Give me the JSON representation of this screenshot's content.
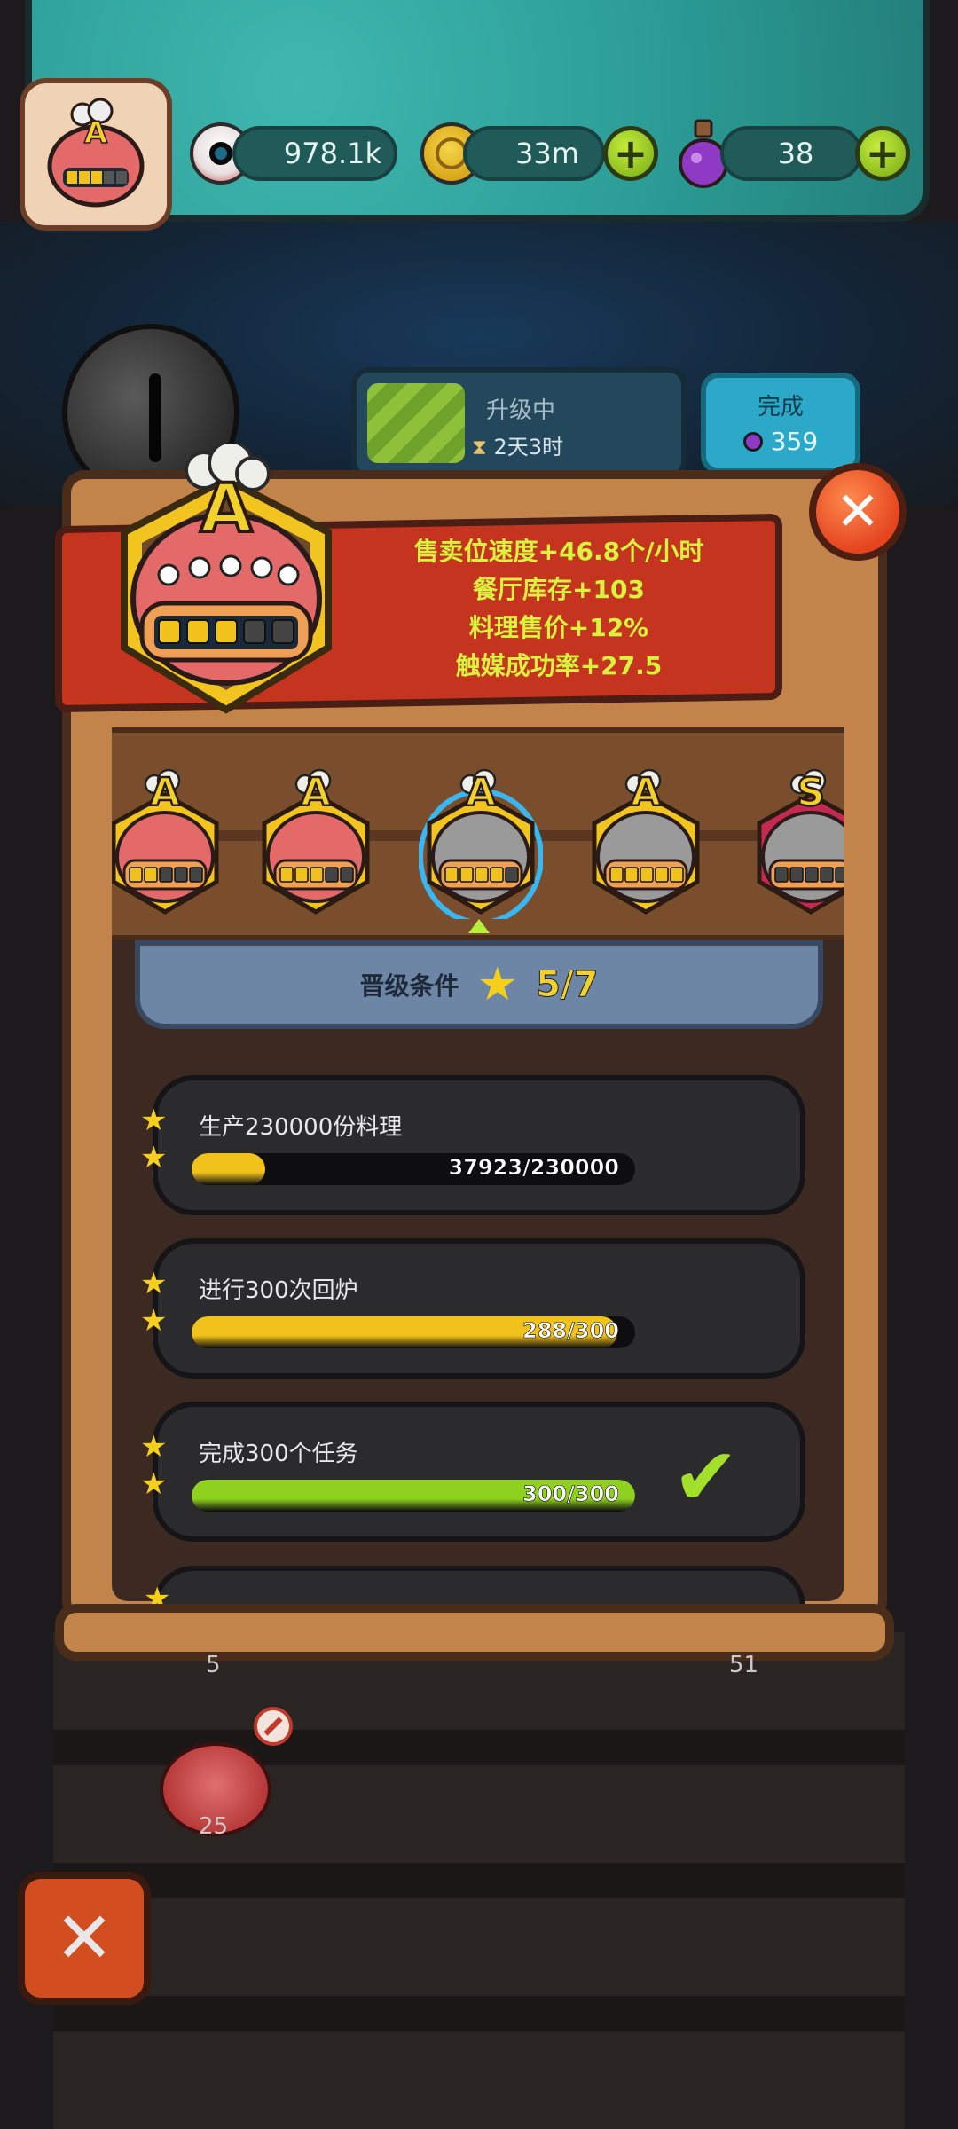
{
  "resources": {
    "eyes": "978.1k",
    "coins": "33m",
    "potions": "38"
  },
  "player_badge": {
    "grade": "A"
  },
  "upgrade_status": {
    "label": "升级中",
    "time_icon": "⧗",
    "time": "2天3时",
    "complete_label": "完成",
    "complete_cost": "359"
  },
  "bonuses": [
    "售卖位速度+46.8个/小时",
    "餐厅库存+103",
    "料理售价+12%",
    "触媒成功率+27.5"
  ],
  "big_badge": {
    "grade": "A",
    "level_filled": 3,
    "level_total": 5
  },
  "badges": [
    {
      "grade": "A",
      "color": "#e46a6a",
      "filled": 2,
      "total": 5
    },
    {
      "grade": "A",
      "color": "#e46a6a",
      "filled": 3,
      "total": 5
    },
    {
      "grade": "A",
      "color": "#9a9a9a",
      "filled": 4,
      "total": 5,
      "selected": true
    },
    {
      "grade": "A",
      "color": "#9a9a9a",
      "filled": 5,
      "total": 5
    },
    {
      "grade": "S",
      "color": "#9a9a9a",
      "filled": 0,
      "total": 5
    }
  ],
  "requirements": {
    "label": "晋级条件",
    "count": "5/7"
  },
  "conditions": [
    {
      "title": "生产230000份料理",
      "progress_text": "37923/230000",
      "progress": 0.165,
      "color": "#f2c21c",
      "done": false
    },
    {
      "title": "进行300次回炉",
      "progress_text": "288/300",
      "progress": 0.96,
      "color": "#f2c21c",
      "done": false
    },
    {
      "title": "完成300个任务",
      "progress_text": "300/300",
      "progress": 1.0,
      "color": "#8ed11e",
      "done": true
    }
  ],
  "background_numbers": [
    "5",
    "51",
    "25"
  ],
  "colors": {
    "panel_wood": "#c2844a",
    "banner_red": "#c5341f",
    "bonus_text": "#d8f23e",
    "accent_green": "#8ed11e",
    "accent_yellow": "#f2c21c"
  },
  "icons": [
    "eyeball-icon",
    "coin-icon",
    "potion-icon",
    "plus-icon",
    "hourglass-icon",
    "close-icon",
    "star-icon",
    "check-icon",
    "no-entry-icon"
  ]
}
